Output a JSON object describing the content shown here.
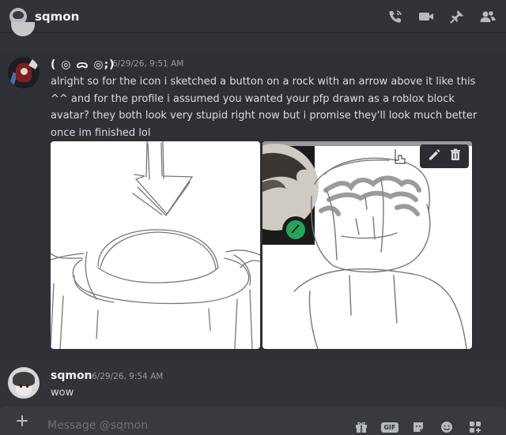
{
  "header": {
    "title": "sqmon",
    "icons": [
      "phone-call-icon",
      "video-camera-icon",
      "pin-icon",
      "members-icon"
    ]
  },
  "messages": [
    {
      "username": "( ◎ ᯅ ◎;)",
      "timestamp": "6/29/26, 9:51 AM",
      "body": "alright so for the icon i sketched a button on a rock with an arrow above it like this ^^  and for the profile i assumed you wanted your pfp drawn as a roblox block avatar? they both look very stupid right now but i promise they'll look much better once im finished lol"
    },
    {
      "username": "sqmon",
      "timestamp": "6/29/26, 9:54 AM",
      "body": "wow"
    }
  ],
  "composer": {
    "placeholder": "Message @sqmon",
    "icons": [
      "gift-icon",
      "gif-icon",
      "sticker-icon",
      "emoji-icon",
      "apps-icon"
    ],
    "gif_label": "GIF"
  },
  "colors": {
    "background": "#313338",
    "message_hover": "#2e3035",
    "header_border": "#232428",
    "composer_bg": "#383a40",
    "text_primary": "#dbdee1",
    "text_muted": "#949ba4",
    "status_green": "#23a55a"
  }
}
